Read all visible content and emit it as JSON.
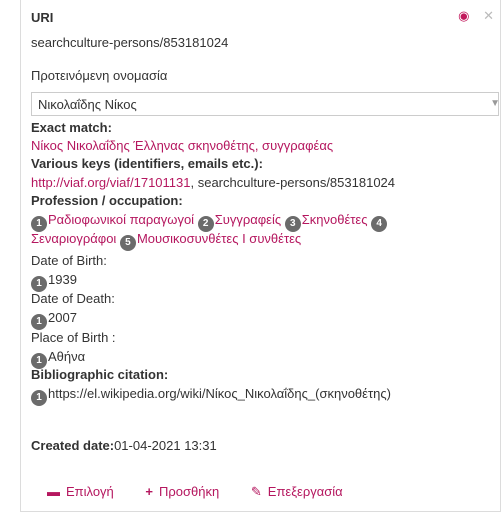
{
  "header": {
    "title": "URI"
  },
  "uri_value": "searchculture-persons/853181024",
  "proposed_name": {
    "label": "Προτεινόμενη ονομασία",
    "selected": "Νικολαΐδης Νίκος"
  },
  "exact_match": {
    "label": "Exact match:",
    "value": "Νίκος Νικολαΐδης Έλληνας σκηνοθέτης, συγγραφέας"
  },
  "keys": {
    "label": "Various keys (identifiers, emails etc.):",
    "link": "http://viaf.org/viaf/17101131",
    "rest": ", searchculture-persons/853181024"
  },
  "profession": {
    "label": "Profession / occupation:",
    "items": [
      {
        "n": "1",
        "text": "Ραδιοφωνικοί παραγωγοί"
      },
      {
        "n": "2",
        "text": "Συγγραφείς"
      },
      {
        "n": "3",
        "text": "Σκηνοθέτες"
      },
      {
        "n": "4",
        "text": "Σεναριογράφοι"
      },
      {
        "n": "5",
        "text": "Μουσικοσυνθέτες I συνθέτες"
      }
    ]
  },
  "birth_date": {
    "label": "Date of Birth:",
    "n": "1",
    "value": "1939"
  },
  "death_date": {
    "label": "Date of Death:",
    "n": "1",
    "value": "2007"
  },
  "birth_place": {
    "label": "Place of Birth :",
    "n": "1",
    "value": "Αθήνα"
  },
  "citation": {
    "label": "Bibliographic citation:",
    "n": "1",
    "value": "https://el.wikipedia.org/wiki/Νίκος_Νικολαΐδης_(σκηνοθέτης)"
  },
  "created": {
    "label": "Created date:",
    "value": "01-04-2021 13:31"
  },
  "actions": {
    "select": "Επιλογή",
    "add": "Προσθήκη",
    "edit": "Επεξεργασία"
  }
}
